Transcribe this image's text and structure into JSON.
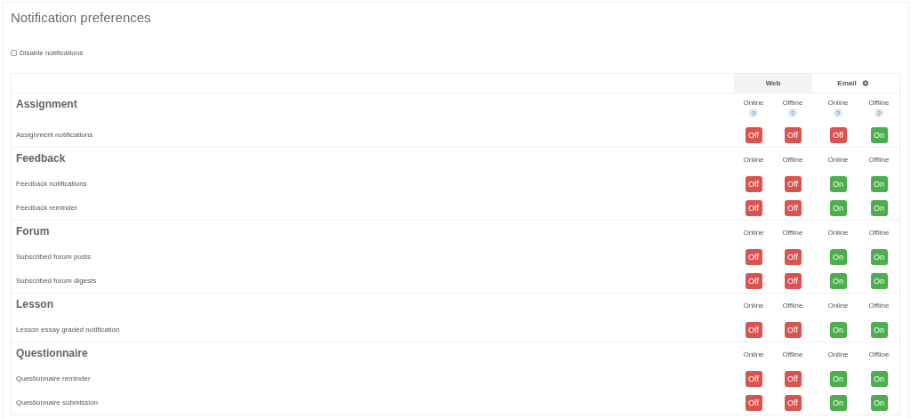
{
  "title": "Notification preferences",
  "disable": {
    "label": "Disable notifications",
    "checked": false
  },
  "processors": [
    {
      "label": "Web",
      "settings": false
    },
    {
      "label": "Email",
      "settings": true
    }
  ],
  "sections": [
    {
      "heading": "Assignment",
      "columns": [
        {
          "label": "Online",
          "help": "?"
        },
        {
          "label": "Offline",
          "help": "?"
        },
        {
          "label": "Online",
          "help": "?"
        },
        {
          "label": "Offline",
          "help": "?"
        }
      ],
      "items": [
        {
          "label": "Assignment notifications",
          "toggles": [
            {
              "label": "Off",
              "on": false
            },
            {
              "label": "Off",
              "on": false
            },
            {
              "label": "Off",
              "on": false
            },
            {
              "label": "On",
              "on": true
            }
          ]
        }
      ]
    },
    {
      "heading": "Feedback",
      "columns": [
        {
          "label": "Online"
        },
        {
          "label": "Offline"
        },
        {
          "label": "Online"
        },
        {
          "label": "Offline"
        }
      ],
      "items": [
        {
          "label": "Feedback notifications",
          "toggles": [
            {
              "label": "Off",
              "on": false
            },
            {
              "label": "Off",
              "on": false
            },
            {
              "label": "On",
              "on": true
            },
            {
              "label": "On",
              "on": true
            }
          ]
        },
        {
          "label": "Feedback reminder",
          "toggles": [
            {
              "label": "Off",
              "on": false
            },
            {
              "label": "Off",
              "on": false
            },
            {
              "label": "On",
              "on": true
            },
            {
              "label": "On",
              "on": true
            }
          ]
        }
      ]
    },
    {
      "heading": "Forum",
      "columns": [
        {
          "label": "Online"
        },
        {
          "label": "Offline"
        },
        {
          "label": "Online"
        },
        {
          "label": "Offline"
        }
      ],
      "items": [
        {
          "label": "Subscribed forum posts",
          "toggles": [
            {
              "label": "Off",
              "on": false
            },
            {
              "label": "Off",
              "on": false
            },
            {
              "label": "On",
              "on": true
            },
            {
              "label": "On",
              "on": true
            }
          ]
        },
        {
          "label": "Subscribed forum digests",
          "toggles": [
            {
              "label": "Off",
              "on": false
            },
            {
              "label": "Off",
              "on": false
            },
            {
              "label": "On",
              "on": true
            },
            {
              "label": "On",
              "on": true
            }
          ]
        }
      ]
    },
    {
      "heading": "Lesson",
      "columns": [
        {
          "label": "Online"
        },
        {
          "label": "Offline"
        },
        {
          "label": "Online"
        },
        {
          "label": "Offline"
        }
      ],
      "items": [
        {
          "label": "Lesson essay graded notification",
          "toggles": [
            {
              "label": "Off",
              "on": false
            },
            {
              "label": "Off",
              "on": false
            },
            {
              "label": "On",
              "on": true
            },
            {
              "label": "On",
              "on": true
            }
          ]
        }
      ]
    },
    {
      "heading": "Questionnaire",
      "columns": [
        {
          "label": "Online"
        },
        {
          "label": "Offline"
        },
        {
          "label": "Online"
        },
        {
          "label": "Offline"
        }
      ],
      "items": [
        {
          "label": "Questionnaire reminder",
          "toggles": [
            {
              "label": "Off",
              "on": false
            },
            {
              "label": "Off",
              "on": false
            },
            {
              "label": "On",
              "on": true
            },
            {
              "label": "On",
              "on": true
            }
          ]
        },
        {
          "label": "Questionnaire submission",
          "toggles": [
            {
              "label": "Off",
              "on": false
            },
            {
              "label": "Off",
              "on": false
            },
            {
              "label": "On",
              "on": true
            },
            {
              "label": "On",
              "on": true
            }
          ]
        }
      ]
    }
  ]
}
